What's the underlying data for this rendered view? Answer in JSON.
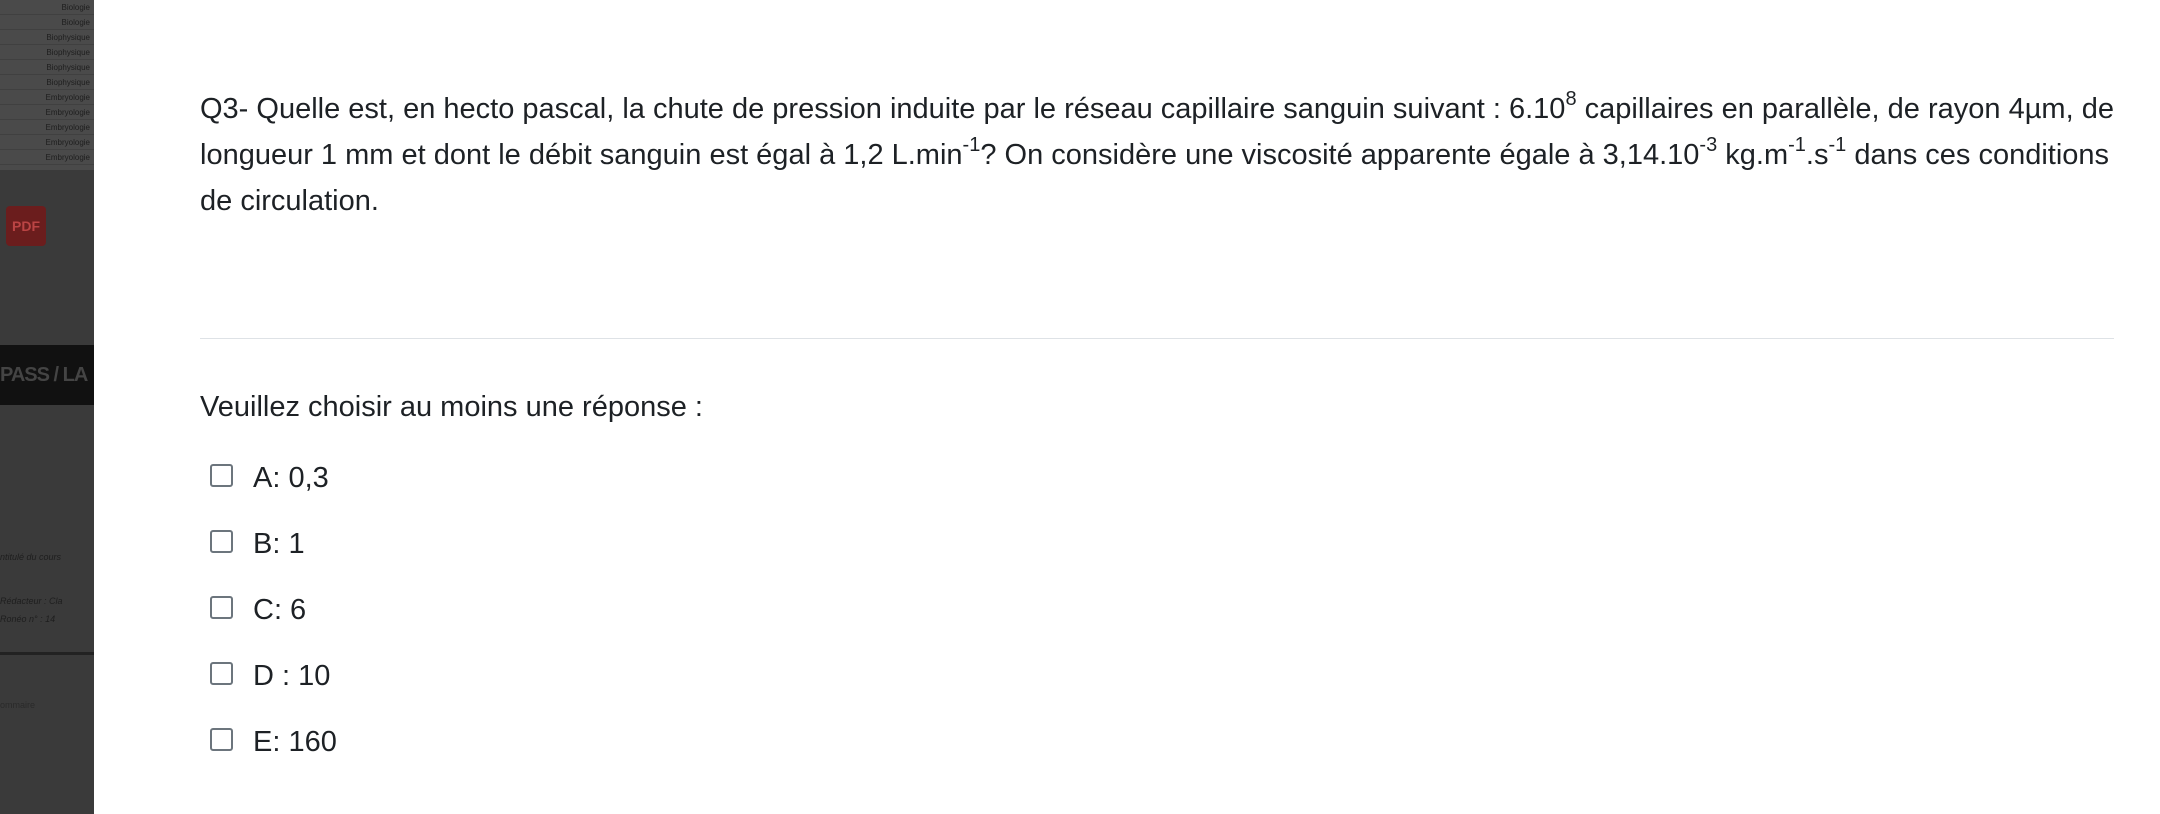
{
  "question": {
    "part1": "Q3- Quelle est, en hecto pascal, la chute de pression induite par le réseau capillaire sanguin suivant : 6.10",
    "sup1": "8",
    "part2": " capillaires en parallèle, de rayon 4µm, de longueur 1 mm et dont le débit sanguin est égal à 1,2 L.min",
    "sup2": "-1",
    "part3": "? On considère une viscosité apparente égale à 3,14.10",
    "sup3": "-3",
    "part4": " kg.m",
    "sup4": "-1",
    "part5": ".s",
    "sup5": "-1",
    "part6": " dans ces conditions de circulation."
  },
  "prompt": "Veuillez choisir au moins une réponse :",
  "answers": [
    {
      "label": "A: 0,3",
      "checked": false
    },
    {
      "label": "B: 1",
      "checked": false
    },
    {
      "label": "C: 6",
      "checked": false
    },
    {
      "label": "D : 10",
      "checked": false
    },
    {
      "label": "E: 160",
      "checked": false
    }
  ],
  "backdrop": {
    "list_items": [
      "Biologie",
      "Biologie",
      "Biophysique",
      "Biophysique",
      "Biophysique",
      "Biophysique",
      "Embryologie",
      "Embryologie",
      "Embryologie",
      "Embryologie",
      "Embryologie"
    ],
    "pdf_badge": "PDF",
    "band_text": "PASS / LA",
    "note1": "ntitulé du cours",
    "note2": "Rédacteur : Cla",
    "note3": "Ronéo n° : 14",
    "note4": "ommaire"
  }
}
